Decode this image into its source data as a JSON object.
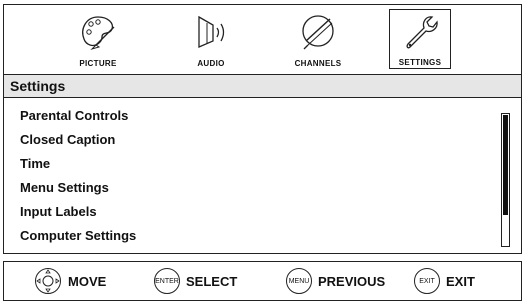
{
  "tabs": [
    {
      "label": "PICTURE",
      "icon": "palette-icon",
      "active": false
    },
    {
      "label": "AUDIO",
      "icon": "speaker-icon",
      "active": false
    },
    {
      "label": "CHANNELS",
      "icon": "satellite-dish-icon",
      "active": false
    },
    {
      "label": "SETTINGS",
      "icon": "wrench-icon",
      "active": true
    }
  ],
  "page_title": "Settings",
  "menu_items": [
    "Parental Controls",
    "Closed Caption",
    "Time",
    "Menu Settings",
    "Input Labels",
    "Computer Settings"
  ],
  "footer": {
    "move": {
      "label": "MOVE",
      "key_icon": "dpad-icon"
    },
    "select": {
      "label": "SELECT",
      "key": "ENTER"
    },
    "previous": {
      "label": "PREVIOUS",
      "key": "MENU"
    },
    "exit": {
      "label": "EXIT",
      "key": "EXIT"
    }
  }
}
